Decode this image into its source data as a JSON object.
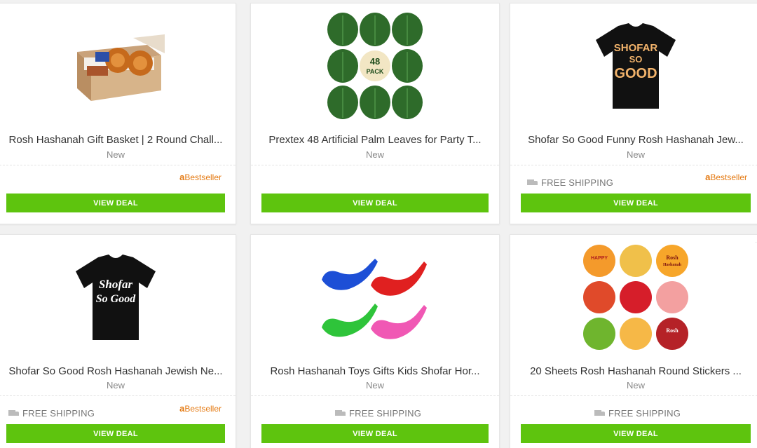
{
  "cards": [
    {
      "title": "Rosh Hashanah Gift Basket | 2 Round Chall...",
      "condition": "New",
      "badge": "Bestseller",
      "shipping": "",
      "button": "VIEW DEAL"
    },
    {
      "title": "Prextex 48 Artificial Palm Leaves for Party T...",
      "condition": "New",
      "badge": "",
      "shipping": "",
      "button": "VIEW DEAL",
      "image_text": "48 PACK"
    },
    {
      "title": "Shofar So Good Funny Rosh Hashanah Jew...",
      "condition": "New",
      "badge": "Bestseller",
      "shipping": "FREE SHIPPING",
      "button": "VIEW DEAL",
      "image_text": [
        "SHOFAR",
        "SO",
        "GOOD"
      ]
    },
    {
      "title": "Shofar So Good Rosh Hashanah Jewish Ne...",
      "condition": "New",
      "badge": "Bestseller",
      "shipping": "FREE SHIPPING",
      "button": "VIEW DEAL",
      "image_text": [
        "Shofar",
        "So Good"
      ]
    },
    {
      "title": "Rosh Hashanah Toys Gifts Kids Shofar Hor...",
      "condition": "New",
      "badge": "",
      "shipping": "FREE SHIPPING",
      "button": "VIEW DEAL"
    },
    {
      "title": "20 Sheets Rosh Hashanah Round Stickers ...",
      "condition": "New",
      "badge": "",
      "shipping": "FREE SHIPPING",
      "button": "VIEW DEAL",
      "image_text": [
        "HAPPY",
        "Rosh",
        "Hashanah"
      ]
    }
  ],
  "badge_logo": "a",
  "colors": {
    "accent": "#5ec40e",
    "badge": "#e47911"
  }
}
